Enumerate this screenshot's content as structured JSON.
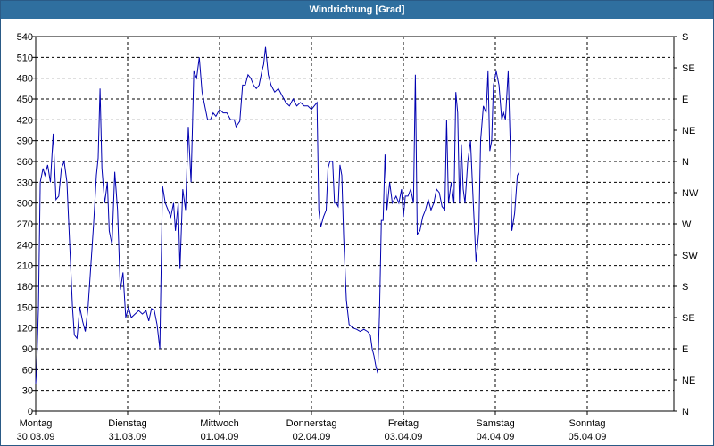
{
  "window": {
    "title": "Windrichtung [Grad]"
  },
  "chart_data": {
    "type": "line",
    "title": "Windrichtung [Grad]",
    "ylim": [
      0,
      540
    ],
    "y_ticks": [
      0,
      30,
      60,
      90,
      120,
      150,
      180,
      210,
      240,
      270,
      300,
      330,
      360,
      390,
      420,
      450,
      480,
      510,
      540
    ],
    "right_axis_labels": [
      "N",
      "NE",
      "E",
      "SE",
      "S",
      "SW",
      "W",
      "NW",
      "N",
      "NE",
      "E",
      "SE",
      "S"
    ],
    "right_axis_values": [
      0,
      45,
      90,
      135,
      180,
      225,
      270,
      315,
      360,
      405,
      450,
      495,
      540
    ],
    "xlim": [
      0,
      7
    ],
    "x_ticks": [
      {
        "day": "Montag",
        "date": "30.03.09",
        "x": 0
      },
      {
        "day": "Dienstag",
        "date": "31.03.09",
        "x": 1
      },
      {
        "day": "Mittwoch",
        "date": "01.04.09",
        "x": 2
      },
      {
        "day": "Donnerstag",
        "date": "02.04.09",
        "x": 3
      },
      {
        "day": "Freitag",
        "date": "03.04.09",
        "x": 4
      },
      {
        "day": "Samstag",
        "date": "04.04.09",
        "x": 5
      },
      {
        "day": "Sonntag",
        "date": "05.04.09",
        "x": 6
      }
    ],
    "grid": true,
    "line_color": "#0000b0",
    "series": [
      {
        "points": [
          [
            0.0,
            40
          ],
          [
            0.01,
            60
          ],
          [
            0.03,
            150
          ],
          [
            0.05,
            330
          ],
          [
            0.08,
            350
          ],
          [
            0.1,
            340
          ],
          [
            0.13,
            355
          ],
          [
            0.16,
            330
          ],
          [
            0.19,
            400
          ],
          [
            0.22,
            305
          ],
          [
            0.25,
            310
          ],
          [
            0.28,
            350
          ],
          [
            0.31,
            360
          ],
          [
            0.34,
            330
          ],
          [
            0.37,
            240
          ],
          [
            0.4,
            150
          ],
          [
            0.42,
            110
          ],
          [
            0.45,
            105
          ],
          [
            0.48,
            150
          ],
          [
            0.51,
            130
          ],
          [
            0.54,
            115
          ],
          [
            0.57,
            150
          ],
          [
            0.6,
            210
          ],
          [
            0.63,
            270
          ],
          [
            0.66,
            340
          ],
          [
            0.68,
            365
          ],
          [
            0.7,
            465
          ],
          [
            0.72,
            350
          ],
          [
            0.75,
            300
          ],
          [
            0.78,
            330
          ],
          [
            0.8,
            260
          ],
          [
            0.83,
            240
          ],
          [
            0.86,
            345
          ],
          [
            0.89,
            290
          ],
          [
            0.92,
            175
          ],
          [
            0.95,
            200
          ],
          [
            0.98,
            135
          ],
          [
            1.01,
            150
          ],
          [
            1.04,
            135
          ],
          [
            1.08,
            140
          ],
          [
            1.12,
            145
          ],
          [
            1.16,
            140
          ],
          [
            1.2,
            145
          ],
          [
            1.23,
            130
          ],
          [
            1.26,
            148
          ],
          [
            1.29,
            145
          ],
          [
            1.32,
            125
          ],
          [
            1.35,
            90
          ],
          [
            1.38,
            325
          ],
          [
            1.41,
            300
          ],
          [
            1.44,
            290
          ],
          [
            1.47,
            280
          ],
          [
            1.5,
            300
          ],
          [
            1.52,
            260
          ],
          [
            1.55,
            300
          ],
          [
            1.57,
            205
          ],
          [
            1.6,
            320
          ],
          [
            1.63,
            290
          ],
          [
            1.66,
            410
          ],
          [
            1.69,
            330
          ],
          [
            1.72,
            490
          ],
          [
            1.75,
            480
          ],
          [
            1.78,
            510
          ],
          [
            1.81,
            460
          ],
          [
            1.84,
            440
          ],
          [
            1.87,
            420
          ],
          [
            1.9,
            420
          ],
          [
            1.93,
            430
          ],
          [
            1.96,
            425
          ],
          [
            2.0,
            435
          ],
          [
            2.04,
            430
          ],
          [
            2.08,
            430
          ],
          [
            2.12,
            420
          ],
          [
            2.16,
            420
          ],
          [
            2.18,
            410
          ],
          [
            2.22,
            418
          ],
          [
            2.25,
            470
          ],
          [
            2.28,
            470
          ],
          [
            2.31,
            485
          ],
          [
            2.34,
            480
          ],
          [
            2.37,
            470
          ],
          [
            2.4,
            465
          ],
          [
            2.43,
            470
          ],
          [
            2.46,
            490
          ],
          [
            2.48,
            500
          ],
          [
            2.5,
            525
          ],
          [
            2.53,
            485
          ],
          [
            2.56,
            470
          ],
          [
            2.6,
            460
          ],
          [
            2.64,
            465
          ],
          [
            2.68,
            455
          ],
          [
            2.72,
            445
          ],
          [
            2.76,
            440
          ],
          [
            2.8,
            450
          ],
          [
            2.84,
            440
          ],
          [
            2.88,
            445
          ],
          [
            2.92,
            440
          ],
          [
            2.96,
            440
          ],
          [
            3.0,
            435
          ],
          [
            3.03,
            440
          ],
          [
            3.06,
            445
          ],
          [
            3.08,
            290
          ],
          [
            3.1,
            265
          ],
          [
            3.13,
            280
          ],
          [
            3.16,
            290
          ],
          [
            3.18,
            350
          ],
          [
            3.2,
            360
          ],
          [
            3.23,
            360
          ],
          [
            3.25,
            300
          ],
          [
            3.27,
            300
          ],
          [
            3.29,
            295
          ],
          [
            3.31,
            355
          ],
          [
            3.33,
            340
          ],
          [
            3.35,
            250
          ],
          [
            3.38,
            160
          ],
          [
            3.41,
            125
          ],
          [
            3.45,
            120
          ],
          [
            3.49,
            118
          ],
          [
            3.53,
            115
          ],
          [
            3.57,
            118
          ],
          [
            3.61,
            115
          ],
          [
            3.64,
            110
          ],
          [
            3.66,
            90
          ],
          [
            3.68,
            80
          ],
          [
            3.7,
            65
          ],
          [
            3.72,
            55
          ],
          [
            3.74,
            140
          ],
          [
            3.76,
            275
          ],
          [
            3.78,
            275
          ],
          [
            3.8,
            370
          ],
          [
            3.82,
            290
          ],
          [
            3.85,
            330
          ],
          [
            3.88,
            300
          ],
          [
            3.92,
            310
          ],
          [
            3.95,
            300
          ],
          [
            3.98,
            320
          ],
          [
            4.0,
            280
          ],
          [
            4.02,
            310
          ],
          [
            4.05,
            310
          ],
          [
            4.08,
            320
          ],
          [
            4.11,
            300
          ],
          [
            4.13,
            485
          ],
          [
            4.15,
            255
          ],
          [
            4.18,
            260
          ],
          [
            4.21,
            280
          ],
          [
            4.24,
            290
          ],
          [
            4.27,
            305
          ],
          [
            4.3,
            290
          ],
          [
            4.33,
            300
          ],
          [
            4.36,
            320
          ],
          [
            4.39,
            315
          ],
          [
            4.42,
            295
          ],
          [
            4.45,
            290
          ],
          [
            4.47,
            420
          ],
          [
            4.49,
            300
          ],
          [
            4.52,
            330
          ],
          [
            4.55,
            300
          ],
          [
            4.57,
            460
          ],
          [
            4.59,
            430
          ],
          [
            4.61,
            300
          ],
          [
            4.63,
            385
          ],
          [
            4.65,
            320
          ],
          [
            4.67,
            300
          ],
          [
            4.7,
            360
          ],
          [
            4.73,
            390
          ],
          [
            4.76,
            300
          ],
          [
            4.79,
            215
          ],
          [
            4.82,
            260
          ],
          [
            4.84,
            390
          ],
          [
            4.87,
            440
          ],
          [
            4.9,
            430
          ],
          [
            4.92,
            490
          ],
          [
            4.94,
            375
          ],
          [
            4.96,
            390
          ],
          [
            4.98,
            470
          ],
          [
            5.01,
            490
          ],
          [
            5.04,
            470
          ],
          [
            5.07,
            420
          ],
          [
            5.09,
            430
          ],
          [
            5.11,
            420
          ],
          [
            5.14,
            490
          ],
          [
            5.16,
            395
          ],
          [
            5.18,
            260
          ],
          [
            5.21,
            285
          ],
          [
            5.24,
            340
          ],
          [
            5.26,
            345
          ]
        ]
      }
    ]
  }
}
